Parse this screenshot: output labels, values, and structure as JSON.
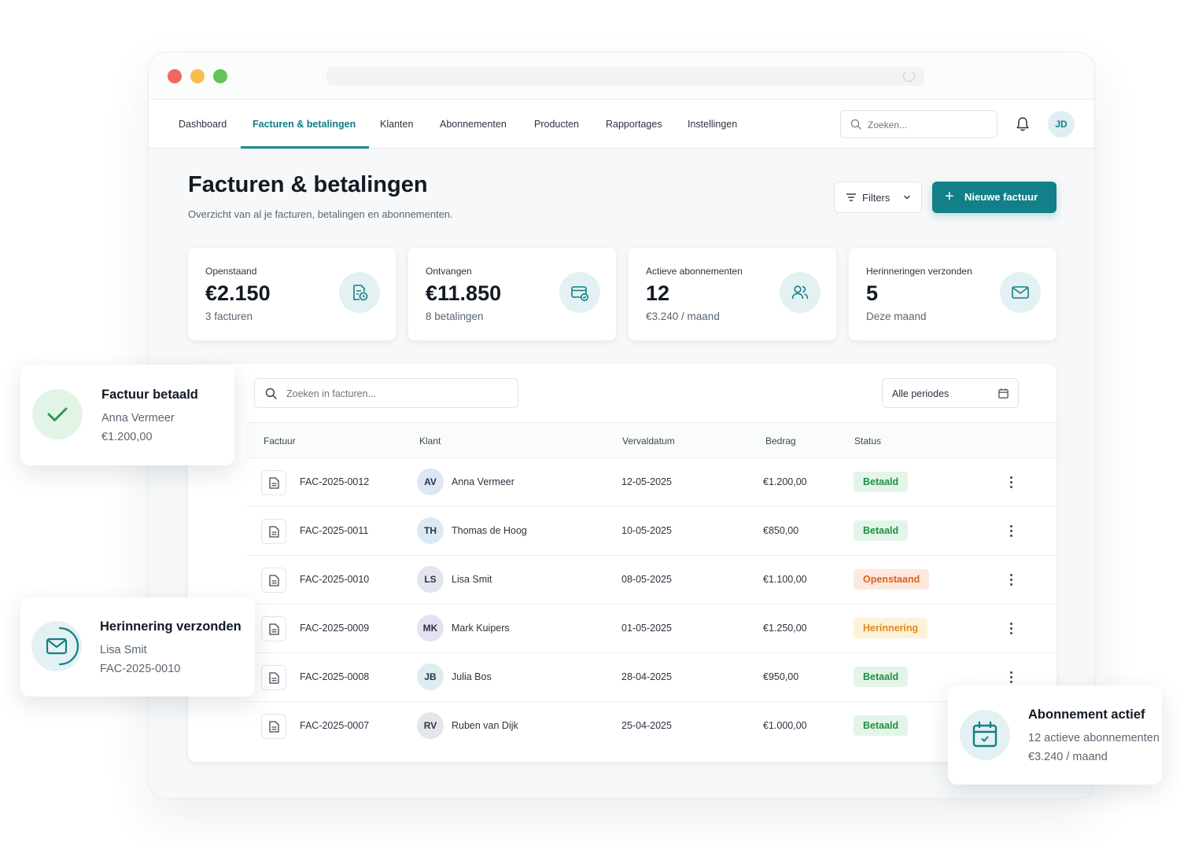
{
  "nav": {
    "items": [
      "Dashboard",
      "Facturen & betalingen",
      "Klanten",
      "Abonnementen",
      "Producten",
      "Rapportages",
      "Instellingen"
    ],
    "search_placeholder": "Zoeken...",
    "user_initials": "JD"
  },
  "page": {
    "title": "Facturen & betalingen",
    "subtitle": "Overzicht van al je facturen, betalingen en abonnementen.",
    "filters_label": "Filters",
    "new_invoice_label": "Nieuwe factuur"
  },
  "stats": [
    {
      "label": "Openstaand",
      "value": "€2.150",
      "sub": "3 facturen",
      "icon": "invoice-clock-icon"
    },
    {
      "label": "Ontvangen",
      "value": "€11.850",
      "sub": "8 betalingen",
      "icon": "card-check-icon"
    },
    {
      "label": "Actieve abonnementen",
      "value": "12",
      "sub": "€3.240 / maand",
      "icon": "users-icon"
    },
    {
      "label": "Herinneringen verzonden",
      "value": "5",
      "sub": "Deze maand",
      "icon": "mail-icon"
    }
  ],
  "table": {
    "search_placeholder": "Zoeken in facturen...",
    "period_label": "Alle periodes",
    "headers": [
      "Factuur",
      "Klant",
      "Vervaldatum",
      "Bedrag",
      "Status"
    ],
    "rows": [
      {
        "invoice": "FAC-2025-0012",
        "initials": "AV",
        "client": "Anna Vermeer",
        "due": "12-05-2025",
        "amount": "€1.200,00",
        "status": "Betaald",
        "kind": "paid",
        "avatar_color": "#dde6f7"
      },
      {
        "invoice": "FAC-2025-0011",
        "initials": "TH",
        "client": "Thomas de Hoog",
        "due": "10-05-2025",
        "amount": "€850,00",
        "status": "Betaald",
        "kind": "paid",
        "avatar_color": "#dbe9f5"
      },
      {
        "invoice": "FAC-2025-0010",
        "initials": "LS",
        "client": "Lisa Smit",
        "due": "08-05-2025",
        "amount": "€1.100,00",
        "status": "Openstaand",
        "kind": "open",
        "avatar_color": "#e2e5ee"
      },
      {
        "invoice": "FAC-2025-0009",
        "initials": "MK",
        "client": "Mark Kuipers",
        "due": "01-05-2025",
        "amount": "€1.250,00",
        "status": "Herinnering",
        "kind": "remind",
        "avatar_color": "#e4e1f3"
      },
      {
        "invoice": "FAC-2025-0008",
        "initials": "JB",
        "client": "Julia Bos",
        "due": "28-04-2025",
        "amount": "€950,00",
        "status": "Betaald",
        "kind": "paid",
        "avatar_color": "#dcecef"
      },
      {
        "invoice": "FAC-2025-0007",
        "initials": "RV",
        "client": "Ruben van Dijk",
        "due": "25-04-2025",
        "amount": "€1.000,00",
        "status": "Betaald",
        "kind": "paid",
        "avatar_color": "#e3e5ea"
      }
    ]
  },
  "toasts": {
    "paid": {
      "title": "Factuur betaald",
      "line1": "Anna Vermeer",
      "line2": "€1.200,00"
    },
    "reminder": {
      "title": "Herinnering verzonden",
      "line1": "Lisa Smit",
      "line2": "FAC-2025-0010"
    },
    "subscription": {
      "title": "Abonnement actief",
      "line1": "12 actieve abonnementen",
      "line2": "€3.240 / maand"
    }
  },
  "colors": {
    "accent": "#127f89",
    "paid": "#1f8f42",
    "open": "#e2601d",
    "reminder": "#e08b12"
  }
}
